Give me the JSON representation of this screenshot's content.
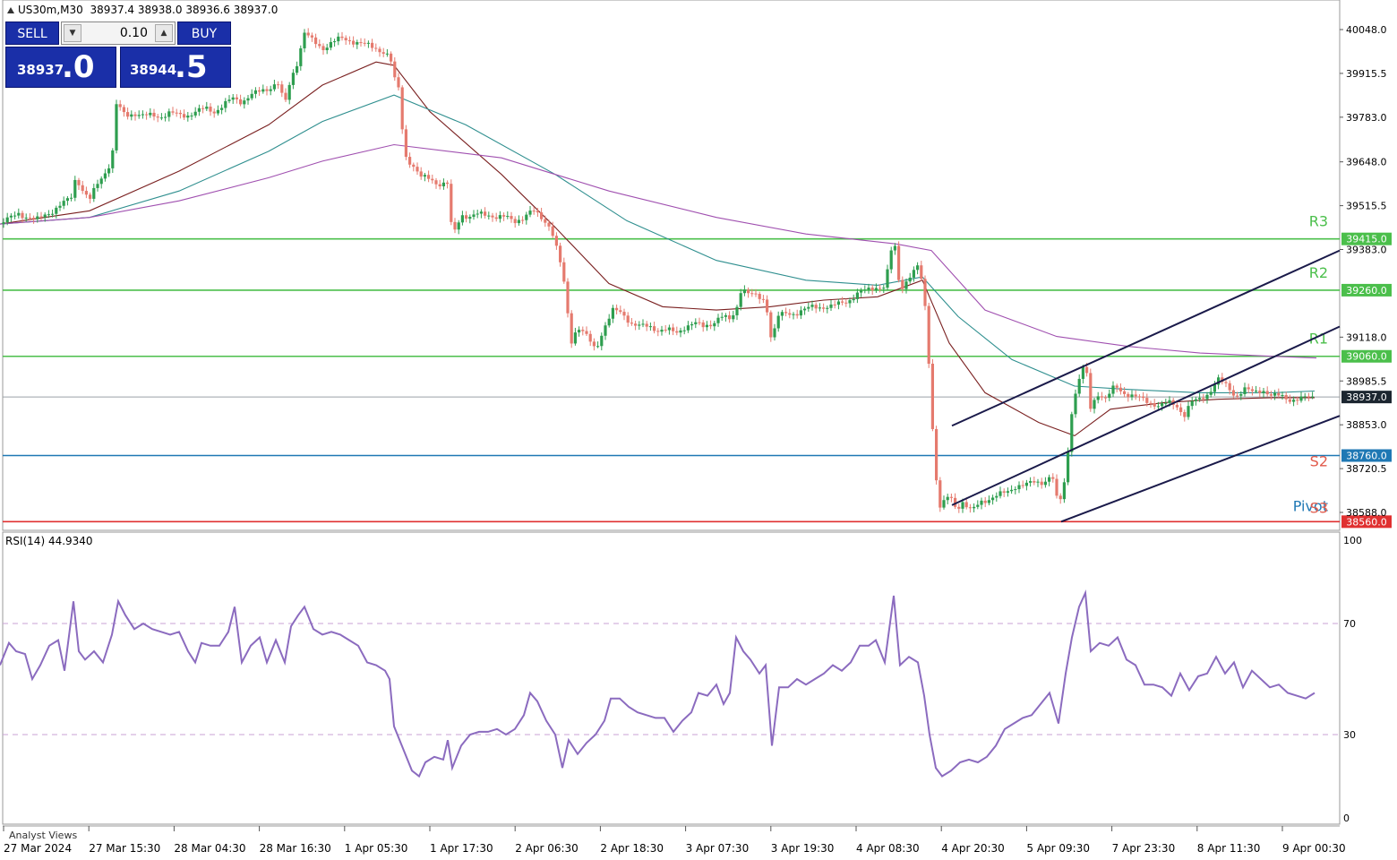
{
  "header": {
    "symbol_tf": "US30m,M30",
    "ohlc": "38937.4 38938.0 38936.6 38937.0"
  },
  "trade_panel": {
    "sell_label": "SELL",
    "buy_label": "BUY",
    "lot": "0.10",
    "sell_price_small": "38937",
    "sell_price_big": ".0",
    "buy_price_small": "38944",
    "buy_price_big": ".5"
  },
  "price_axis": {
    "ticks": [
      "40048.0",
      "39915.5",
      "39783.0",
      "39648.0",
      "39515.5",
      "39383.0",
      "39118.0",
      "38985.5",
      "38853.0",
      "38720.5",
      "38588.0"
    ],
    "tick_values": [
      40048.0,
      39915.5,
      39783.0,
      39648.0,
      39515.5,
      39383.0,
      39118.0,
      38985.5,
      38853.0,
      38720.5,
      38588.0
    ],
    "current": "38937.0",
    "current_value": 38937.0
  },
  "levels": [
    {
      "name": "R3",
      "value": 39415.0,
      "label": "39415.0",
      "color": "#4bbf4b",
      "text_color": "#4bbf4b"
    },
    {
      "name": "R2",
      "value": 39260.0,
      "label": "39260.0",
      "color": "#4bbf4b",
      "text_color": "#4bbf4b"
    },
    {
      "name": "R1",
      "value": 39060.0,
      "label": "39060.0",
      "color": "#4bbf4b",
      "text_color": "#4bbf4b"
    },
    {
      "name": "Pivot",
      "value": 38760.0,
      "label": "38760.0",
      "color": "#1f78b4",
      "text_color": "#1f78b4"
    },
    {
      "name": "S2",
      "value": 38760.0,
      "label": "",
      "color": "#1f78b4",
      "text_color": "#e15a4b"
    },
    {
      "name": "S3",
      "value": 38560.0,
      "label": "38560.0",
      "color": "#e03030",
      "text_color": "#e15a4b"
    }
  ],
  "rsi": {
    "title": "RSI(14) 44.9340",
    "axis_ticks": [
      "100",
      "70",
      "30",
      "0"
    ],
    "axis_values": [
      100,
      70,
      30,
      0
    ]
  },
  "time_axis": {
    "labels": [
      "27 Mar 2024",
      "27 Mar 15:30",
      "28 Mar 04:30",
      "28 Mar 16:30",
      "1 Apr 05:30",
      "1 Apr 17:30",
      "2 Apr 06:30",
      "2 Apr 18:30",
      "3 Apr 07:30",
      "3 Apr 19:30",
      "4 Apr 08:30",
      "4 Apr 20:30",
      "5 Apr 09:30",
      "7 Apr 23:30",
      "8 Apr 11:30",
      "9 Apr 00:30"
    ]
  },
  "analyst_views": "Analyst Views",
  "colors": {
    "bull": "#2e9e4f",
    "bear": "#e57a6e",
    "ma_fast": "#7a2020",
    "ma_mid": "#2f8f8f",
    "ma_slow": "#a050b0",
    "rsi": "#8b6bbf",
    "channel": "#1a1a4a"
  },
  "chart_data": {
    "type": "candlestick",
    "price_path": [
      [
        0,
        39460
      ],
      [
        10,
        39475
      ],
      [
        20,
        39495
      ],
      [
        30,
        39480
      ],
      [
        40,
        39470
      ],
      [
        50,
        39490
      ],
      [
        60,
        39500
      ],
      [
        70,
        39520
      ],
      [
        80,
        39545
      ],
      [
        85,
        39610
      ],
      [
        90,
        39570
      ],
      [
        100,
        39530
      ],
      [
        108,
        39580
      ],
      [
        118,
        39620
      ],
      [
        125,
        39650
      ],
      [
        130,
        39820
      ],
      [
        140,
        39790
      ],
      [
        150,
        39795
      ],
      [
        160,
        39785
      ],
      [
        170,
        39790
      ],
      [
        180,
        39785
      ],
      [
        190,
        39795
      ],
      [
        200,
        39790
      ],
      [
        210,
        39790
      ],
      [
        220,
        39800
      ],
      [
        230,
        39810
      ],
      [
        240,
        39800
      ],
      [
        250,
        39820
      ],
      [
        260,
        39840
      ],
      [
        270,
        39830
      ],
      [
        280,
        39850
      ],
      [
        290,
        39860
      ],
      [
        300,
        39870
      ],
      [
        310,
        39890
      ],
      [
        318,
        39820
      ],
      [
        325,
        39900
      ],
      [
        332,
        39950
      ],
      [
        340,
        40040
      ],
      [
        350,
        40010
      ],
      [
        360,
        39990
      ],
      [
        370,
        40010
      ],
      [
        380,
        40020
      ],
      [
        390,
        40015
      ],
      [
        400,
        40010
      ],
      [
        410,
        40000
      ],
      [
        420,
        39990
      ],
      [
        430,
        39980
      ],
      [
        436,
        39960
      ],
      [
        440,
        39900
      ],
      [
        445,
        39870
      ],
      [
        452,
        39670
      ],
      [
        460,
        39640
      ],
      [
        470,
        39600
      ],
      [
        480,
        39600
      ],
      [
        490,
        39580
      ],
      [
        500,
        39580
      ],
      [
        505,
        39420
      ],
      [
        515,
        39490
      ],
      [
        525,
        39480
      ],
      [
        535,
        39490
      ],
      [
        545,
        39490
      ],
      [
        555,
        39480
      ],
      [
        565,
        39480
      ],
      [
        575,
        39470
      ],
      [
        585,
        39480
      ],
      [
        595,
        39500
      ],
      [
        605,
        39480
      ],
      [
        615,
        39450
      ],
      [
        625,
        39350
      ],
      [
        632,
        39250
      ],
      [
        637,
        39100
      ],
      [
        645,
        39150
      ],
      [
        655,
        39120
      ],
      [
        665,
        39080
      ],
      [
        675,
        39150
      ],
      [
        685,
        39200
      ],
      [
        695,
        39190
      ],
      [
        705,
        39160
      ],
      [
        715,
        39150
      ],
      [
        725,
        39150
      ],
      [
        735,
        39140
      ],
      [
        745,
        39140
      ],
      [
        755,
        39130
      ],
      [
        765,
        39150
      ],
      [
        775,
        39160
      ],
      [
        785,
        39150
      ],
      [
        795,
        39160
      ],
      [
        805,
        39180
      ],
      [
        815,
        39170
      ],
      [
        822,
        39200
      ],
      [
        828,
        39270
      ],
      [
        835,
        39250
      ],
      [
        845,
        39240
      ],
      [
        855,
        39230
      ],
      [
        862,
        39100
      ],
      [
        868,
        39180
      ],
      [
        878,
        39190
      ],
      [
        888,
        39190
      ],
      [
        898,
        39200
      ],
      [
        908,
        39210
      ],
      [
        918,
        39210
      ],
      [
        928,
        39210
      ],
      [
        938,
        39220
      ],
      [
        948,
        39230
      ],
      [
        958,
        39250
      ],
      [
        968,
        39260
      ],
      [
        978,
        39270
      ],
      [
        988,
        39270
      ],
      [
        998,
        39420
      ],
      [
        1005,
        39260
      ],
      [
        1015,
        39300
      ],
      [
        1025,
        39330
      ],
      [
        1030,
        39280
      ],
      [
        1035,
        39160
      ],
      [
        1040,
        38900
      ],
      [
        1045,
        38700
      ],
      [
        1050,
        38600
      ],
      [
        1055,
        38620
      ],
      [
        1060,
        38640
      ],
      [
        1068,
        38600
      ],
      [
        1075,
        38620
      ],
      [
        1085,
        38590
      ],
      [
        1095,
        38620
      ],
      [
        1105,
        38630
      ],
      [
        1115,
        38640
      ],
      [
        1125,
        38650
      ],
      [
        1135,
        38670
      ],
      [
        1145,
        38670
      ],
      [
        1155,
        38680
      ],
      [
        1165,
        38680
      ],
      [
        1175,
        38700
      ],
      [
        1182,
        38600
      ],
      [
        1190,
        38700
      ],
      [
        1197,
        38900
      ],
      [
        1205,
        38990
      ],
      [
        1212,
        39040
      ],
      [
        1218,
        38900
      ],
      [
        1225,
        38950
      ],
      [
        1235,
        38930
      ],
      [
        1245,
        38970
      ],
      [
        1255,
        38950
      ],
      [
        1265,
        38940
      ],
      [
        1275,
        38930
      ],
      [
        1285,
        38920
      ],
      [
        1295,
        38910
      ],
      [
        1305,
        38920
      ],
      [
        1315,
        38910
      ],
      [
        1322,
        38880
      ],
      [
        1330,
        38920
      ],
      [
        1340,
        38930
      ],
      [
        1350,
        38950
      ],
      [
        1360,
        38990
      ],
      [
        1370,
        38970
      ],
      [
        1380,
        38940
      ],
      [
        1390,
        38960
      ],
      [
        1400,
        38950
      ],
      [
        1410,
        38960
      ],
      [
        1420,
        38940
      ],
      [
        1430,
        38940
      ],
      [
        1440,
        38930
      ],
      [
        1450,
        38930
      ],
      [
        1460,
        38935
      ],
      [
        1468,
        38937
      ]
    ],
    "ma_fast": [
      [
        0,
        39460
      ],
      [
        100,
        39500
      ],
      [
        200,
        39620
      ],
      [
        300,
        39760
      ],
      [
        360,
        39880
      ],
      [
        420,
        39950
      ],
      [
        440,
        39940
      ],
      [
        480,
        39800
      ],
      [
        560,
        39610
      ],
      [
        620,
        39450
      ],
      [
        680,
        39280
      ],
      [
        740,
        39210
      ],
      [
        800,
        39200
      ],
      [
        860,
        39210
      ],
      [
        920,
        39230
      ],
      [
        980,
        39240
      ],
      [
        1030,
        39290
      ],
      [
        1060,
        39100
      ],
      [
        1100,
        38950
      ],
      [
        1160,
        38860
      ],
      [
        1200,
        38820
      ],
      [
        1240,
        38900
      ],
      [
        1300,
        38920
      ],
      [
        1360,
        38930
      ],
      [
        1420,
        38935
      ],
      [
        1468,
        38935
      ]
    ],
    "ma_mid": [
      [
        0,
        39460
      ],
      [
        100,
        39480
      ],
      [
        200,
        39560
      ],
      [
        300,
        39680
      ],
      [
        360,
        39770
      ],
      [
        440,
        39850
      ],
      [
        520,
        39760
      ],
      [
        620,
        39610
      ],
      [
        700,
        39470
      ],
      [
        800,
        39350
      ],
      [
        900,
        39290
      ],
      [
        980,
        39275
      ],
      [
        1030,
        39300
      ],
      [
        1070,
        39180
      ],
      [
        1130,
        39050
      ],
      [
        1200,
        38970
      ],
      [
        1260,
        38960
      ],
      [
        1340,
        38950
      ],
      [
        1420,
        38950
      ],
      [
        1468,
        38955
      ]
    ],
    "ma_slow": [
      [
        0,
        39460
      ],
      [
        100,
        39480
      ],
      [
        200,
        39530
      ],
      [
        300,
        39600
      ],
      [
        360,
        39650
      ],
      [
        440,
        39700
      ],
      [
        560,
        39660
      ],
      [
        680,
        39560
      ],
      [
        800,
        39480
      ],
      [
        900,
        39430
      ],
      [
        1000,
        39400
      ],
      [
        1040,
        39380
      ],
      [
        1100,
        39200
      ],
      [
        1180,
        39120
      ],
      [
        1260,
        39090
      ],
      [
        1340,
        39070
      ],
      [
        1420,
        39060
      ],
      [
        1470,
        39055
      ]
    ],
    "channel": [
      [
        [
          1063,
          38850
        ],
        [
          1496,
          39380
        ]
      ],
      [
        [
          1063,
          38610
        ],
        [
          1496,
          39150
        ]
      ],
      [
        [
          1185,
          38560
        ],
        [
          1496,
          38880
        ]
      ]
    ],
    "rsi_path": [
      [
        0,
        55
      ],
      [
        10,
        63
      ],
      [
        18,
        60
      ],
      [
        28,
        59
      ],
      [
        36,
        50
      ],
      [
        45,
        55
      ],
      [
        55,
        62
      ],
      [
        65,
        64
      ],
      [
        72,
        53
      ],
      [
        82,
        78
      ],
      [
        88,
        60
      ],
      [
        95,
        57
      ],
      [
        105,
        60
      ],
      [
        115,
        56
      ],
      [
        125,
        66
      ],
      [
        132,
        78
      ],
      [
        140,
        73
      ],
      [
        150,
        68
      ],
      [
        160,
        70
      ],
      [
        170,
        68
      ],
      [
        180,
        67
      ],
      [
        190,
        66
      ],
      [
        200,
        67
      ],
      [
        210,
        60
      ],
      [
        218,
        56
      ],
      [
        225,
        63
      ],
      [
        235,
        62
      ],
      [
        245,
        62
      ],
      [
        255,
        67
      ],
      [
        262,
        76
      ],
      [
        270,
        56
      ],
      [
        280,
        62
      ],
      [
        290,
        65
      ],
      [
        298,
        56
      ],
      [
        308,
        64
      ],
      [
        318,
        56
      ],
      [
        325,
        69
      ],
      [
        333,
        73
      ],
      [
        340,
        76
      ],
      [
        350,
        68
      ],
      [
        360,
        66
      ],
      [
        370,
        67
      ],
      [
        380,
        66
      ],
      [
        390,
        64
      ],
      [
        400,
        62
      ],
      [
        410,
        56
      ],
      [
        420,
        55
      ],
      [
        430,
        53
      ],
      [
        435,
        50
      ],
      [
        440,
        33
      ],
      [
        450,
        25
      ],
      [
        460,
        17
      ],
      [
        468,
        15
      ],
      [
        475,
        20
      ],
      [
        485,
        22
      ],
      [
        495,
        21
      ],
      [
        500,
        28
      ],
      [
        505,
        18
      ],
      [
        515,
        26
      ],
      [
        525,
        30
      ],
      [
        535,
        31
      ],
      [
        545,
        31
      ],
      [
        555,
        32
      ],
      [
        565,
        30
      ],
      [
        575,
        32
      ],
      [
        585,
        37
      ],
      [
        592,
        45
      ],
      [
        600,
        42
      ],
      [
        610,
        35
      ],
      [
        620,
        30
      ],
      [
        628,
        18
      ],
      [
        635,
        28
      ],
      [
        645,
        23
      ],
      [
        655,
        27
      ],
      [
        665,
        30
      ],
      [
        675,
        35
      ],
      [
        682,
        43
      ],
      [
        692,
        43
      ],
      [
        702,
        40
      ],
      [
        712,
        38
      ],
      [
        722,
        37
      ],
      [
        732,
        36
      ],
      [
        742,
        36
      ],
      [
        752,
        31
      ],
      [
        762,
        35
      ],
      [
        772,
        38
      ],
      [
        780,
        45
      ],
      [
        790,
        44
      ],
      [
        800,
        48
      ],
      [
        808,
        41
      ],
      [
        815,
        45
      ],
      [
        822,
        65
      ],
      [
        830,
        60
      ],
      [
        838,
        57
      ],
      [
        848,
        52
      ],
      [
        855,
        55
      ],
      [
        862,
        26
      ],
      [
        870,
        47
      ],
      [
        880,
        47
      ],
      [
        890,
        50
      ],
      [
        900,
        48
      ],
      [
        910,
        50
      ],
      [
        920,
        52
      ],
      [
        930,
        55
      ],
      [
        940,
        53
      ],
      [
        950,
        56
      ],
      [
        960,
        62
      ],
      [
        970,
        62
      ],
      [
        978,
        64
      ],
      [
        988,
        56
      ],
      [
        998,
        80
      ],
      [
        1005,
        55
      ],
      [
        1015,
        58
      ],
      [
        1025,
        56
      ],
      [
        1032,
        44
      ],
      [
        1038,
        30
      ],
      [
        1045,
        18
      ],
      [
        1052,
        15
      ],
      [
        1062,
        17
      ],
      [
        1072,
        20
      ],
      [
        1082,
        21
      ],
      [
        1092,
        20
      ],
      [
        1102,
        22
      ],
      [
        1112,
        26
      ],
      [
        1122,
        32
      ],
      [
        1132,
        34
      ],
      [
        1142,
        36
      ],
      [
        1152,
        37
      ],
      [
        1162,
        41
      ],
      [
        1172,
        45
      ],
      [
        1182,
        34
      ],
      [
        1190,
        52
      ],
      [
        1197,
        65
      ],
      [
        1205,
        76
      ],
      [
        1212,
        81
      ],
      [
        1218,
        60
      ],
      [
        1228,
        63
      ],
      [
        1238,
        62
      ],
      [
        1248,
        65
      ],
      [
        1258,
        57
      ],
      [
        1268,
        55
      ],
      [
        1278,
        48
      ],
      [
        1288,
        48
      ],
      [
        1298,
        47
      ],
      [
        1308,
        44
      ],
      [
        1318,
        52
      ],
      [
        1328,
        46
      ],
      [
        1338,
        51
      ],
      [
        1348,
        52
      ],
      [
        1358,
        58
      ],
      [
        1368,
        52
      ],
      [
        1378,
        56
      ],
      [
        1388,
        47
      ],
      [
        1398,
        53
      ],
      [
        1408,
        50
      ],
      [
        1418,
        47
      ],
      [
        1428,
        48
      ],
      [
        1438,
        45
      ],
      [
        1448,
        44
      ],
      [
        1458,
        43
      ],
      [
        1468,
        45
      ]
    ]
  }
}
